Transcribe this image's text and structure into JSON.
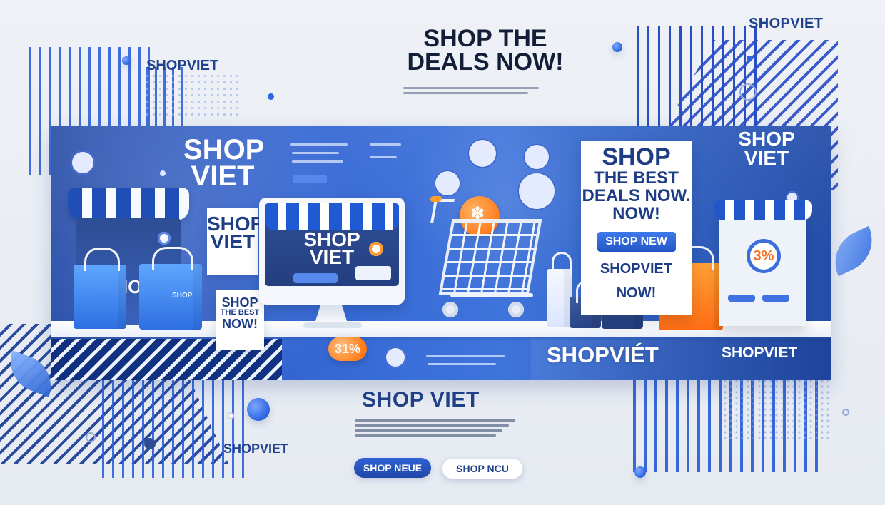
{
  "top_brand": "SHOPVIET",
  "left_brand": "SHOPVIET",
  "bottom_brand": "SHOPVIET",
  "headline": {
    "line1": "SHOP THE",
    "line2": "DEALS NOW!"
  },
  "banner": {
    "left_brand": {
      "line1": "SHOP",
      "line2": "VIET"
    },
    "store_left_label": "SHOP",
    "card_shop_viet": {
      "line1": "SHOP",
      "line2": "VIET"
    },
    "card_best_now": {
      "line1": "SHOP",
      "line2": "THE BEST",
      "line3": "NOW!"
    },
    "monitor_title": {
      "line1": "SHOP",
      "line2": "VIET"
    },
    "discount_left": "31%",
    "deal_card": {
      "line1": "SHOP",
      "line2": "THE BEST",
      "line3": "DEALS NOW.",
      "line4": "NOW!",
      "button": "SHOP NEW",
      "footer_line1": "SHOPVIET",
      "footer_line2": "NOW!"
    },
    "right_brand": {
      "line1": "SHOP",
      "line2": "VIET"
    },
    "percent_badge": "3%",
    "bottom_center_brand": "SHOPVIÉT",
    "bottom_right_brand": "SHOPVIET"
  },
  "cta": {
    "title": "SHOP VIET",
    "primary_button": "SHOP NEUE",
    "secondary_button": "SHOP NCU"
  },
  "icons": {
    "shopping_bag": "shopping-bag-icon",
    "shopping_cart": "shopping-cart-icon",
    "discount": "discount-icon"
  }
}
